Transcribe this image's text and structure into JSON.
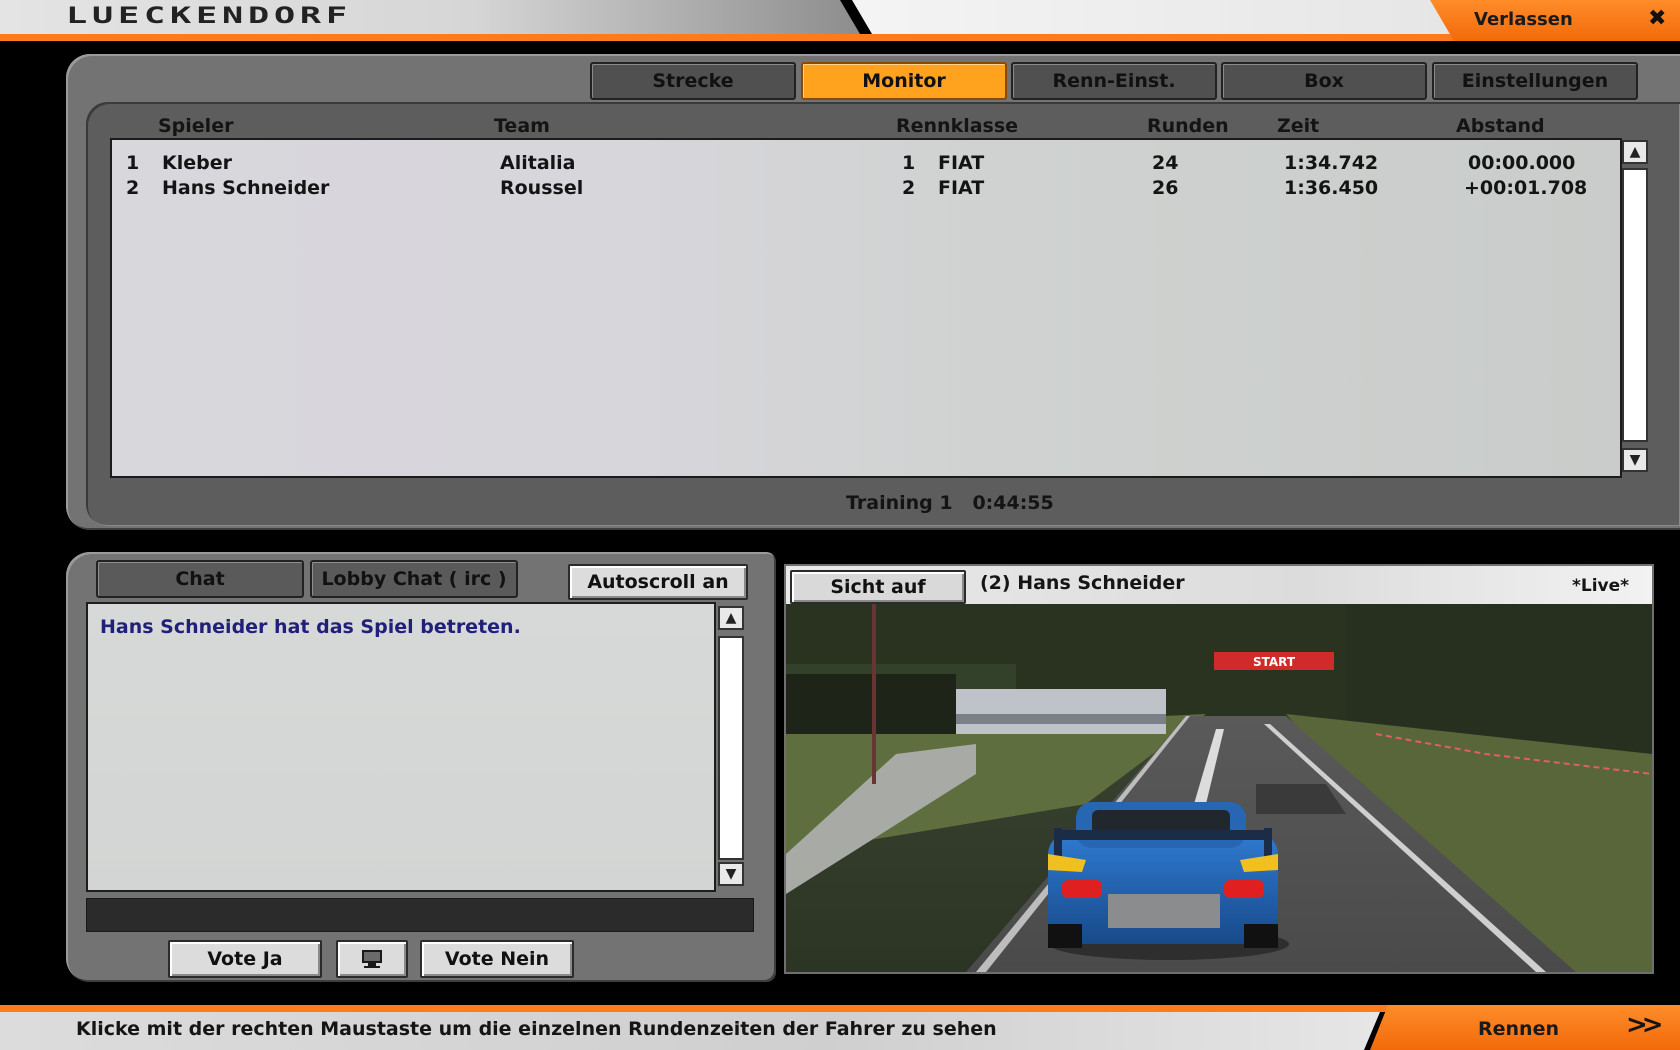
{
  "header": {
    "title": "LUECKENDORF",
    "exit_label": "Verlassen",
    "exit_icon": "close-icon"
  },
  "tabs": [
    {
      "label": "Strecke",
      "active": false
    },
    {
      "label": "Monitor",
      "active": true
    },
    {
      "label": "Renn-Einst.",
      "active": false
    },
    {
      "label": "Box",
      "active": false
    },
    {
      "label": "Einstellungen",
      "active": false
    }
  ],
  "standings": {
    "columns": {
      "player": "Spieler",
      "team": "Team",
      "class": "Rennklasse",
      "laps": "Runden",
      "time": "Zeit",
      "gap": "Abstand"
    },
    "rows": [
      {
        "pos": "1",
        "player": "Kleber",
        "team": "Alitalia",
        "class_no": "1",
        "class_name": "FIAT",
        "laps": "24",
        "time": "1:34.742",
        "gap": "00:00.000"
      },
      {
        "pos": "2",
        "player": "Hans Schneider",
        "team": "Roussel",
        "class_no": "2",
        "class_name": "FIAT",
        "laps": "26",
        "time": "1:36.450",
        "gap": "+00:01.708"
      }
    ],
    "session": "Training 1",
    "session_time": "0:44:55"
  },
  "chat": {
    "tabs": [
      "Chat",
      "Lobby Chat ( irc )"
    ],
    "autoscroll_label": "Autoscroll an",
    "messages": [
      "Hans Schneider hat das Spiel betreten."
    ],
    "input_value": "",
    "vote_yes_label": "Vote Ja",
    "vote_no_label": "Vote Nein",
    "monitor_icon": "monitor-icon"
  },
  "camera": {
    "view_button_label": "Sicht auf",
    "driver_label": "(2) Hans Schneider",
    "live_label": "*Live*",
    "banner_text": "START"
  },
  "footer": {
    "hint": "Klicke mit der rechten Maustaste um die einzelnen Rundenzeiten der Fahrer zu sehen",
    "race_label": "Rennen",
    "race_icon": "double-chevron-right-icon"
  },
  "colors": {
    "accent_orange": "#ff7a1c",
    "active_tab": "#ffa21e",
    "panel_gray": "#737373",
    "chat_text": "#201f7a"
  }
}
